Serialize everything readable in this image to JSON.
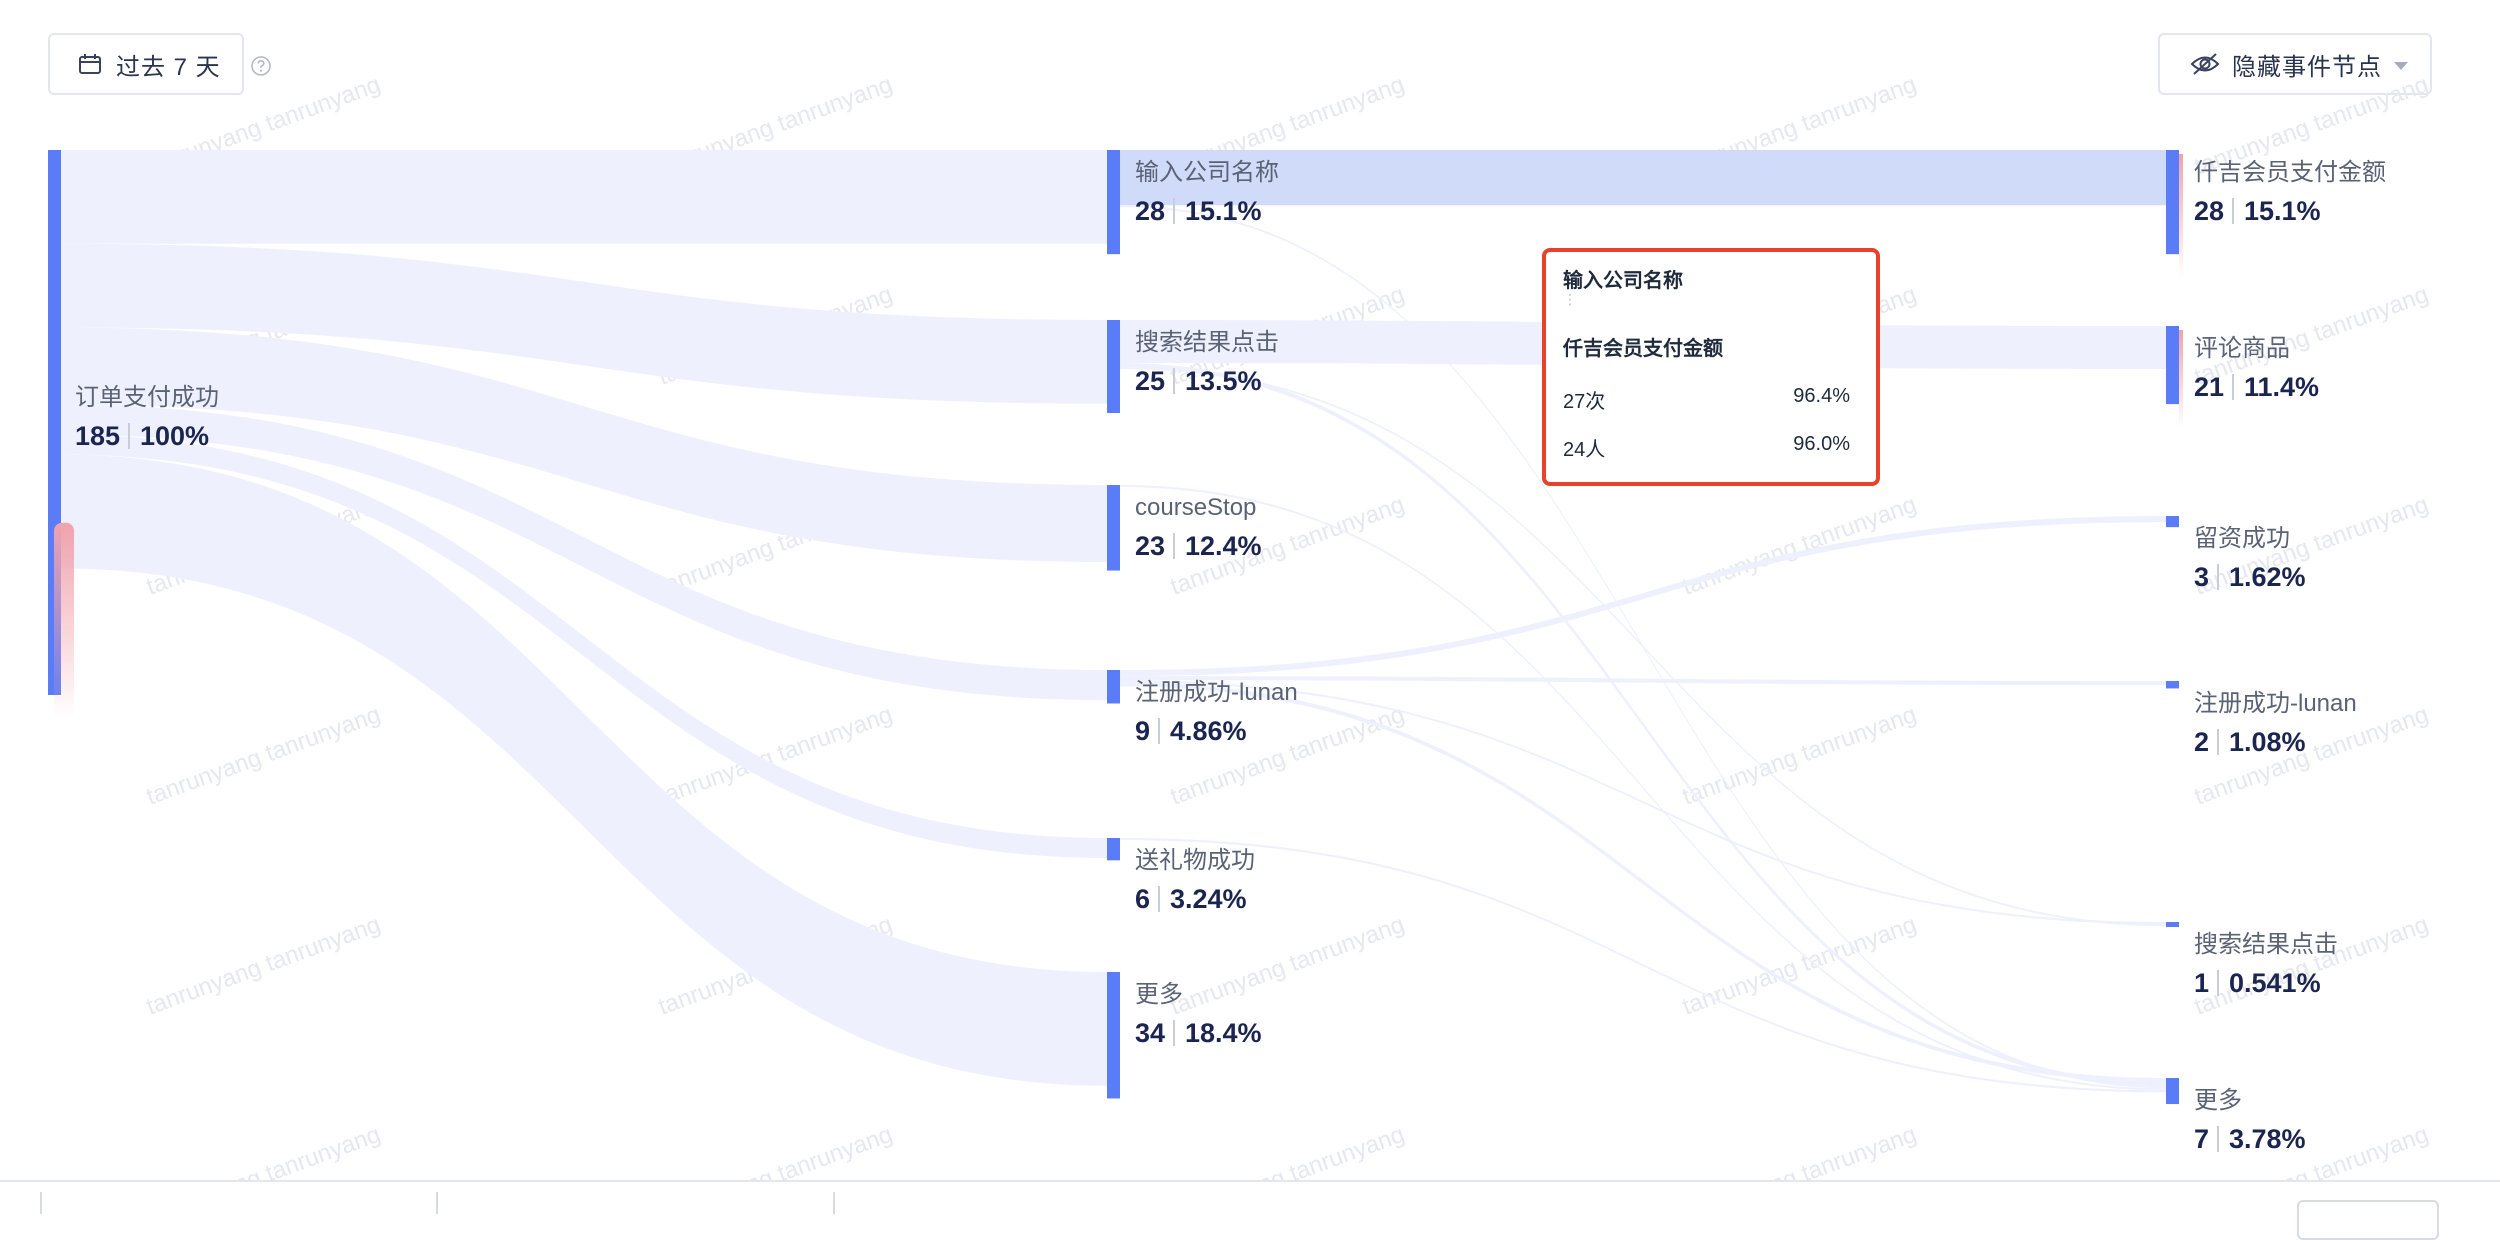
{
  "toolbar": {
    "date_range_label": "过去 7 天",
    "hide_nodes_label": "隐藏事件节点"
  },
  "watermark_text": "tanrunyang tanrunyang",
  "chart_data": {
    "type": "sankey",
    "nodes": [
      {
        "id": "start",
        "column": 0,
        "label": "订单支付成功",
        "count": 185,
        "percent": "100%",
        "dropoff_share": 0.34,
        "color": "#5b7cf7"
      },
      {
        "id": "s1_input",
        "column": 1,
        "label": "输入公司名称",
        "count": 28,
        "percent": "15.1%",
        "color": "#5b7cf7"
      },
      {
        "id": "s1_search",
        "column": 1,
        "label": "搜索结果点击",
        "count": 25,
        "percent": "13.5%",
        "color": "#5b7cf7"
      },
      {
        "id": "s1_course",
        "column": 1,
        "label": "courseStop",
        "count": 23,
        "percent": "12.4%",
        "color": "#5b7cf7"
      },
      {
        "id": "s1_reg",
        "column": 1,
        "label": "注册成功-lunan",
        "count": 9,
        "percent": "4.86%",
        "color": "#5b7cf7"
      },
      {
        "id": "s1_gift",
        "column": 1,
        "label": "送礼物成功",
        "count": 6,
        "percent": "3.24%",
        "color": "#5b7cf7"
      },
      {
        "id": "s1_more",
        "column": 1,
        "label": "更多",
        "count": 34,
        "percent": "18.4%",
        "color": "#5b7cf7"
      },
      {
        "id": "s2_pay",
        "column": 2,
        "label": "仟吉会员支付金额",
        "count": 28,
        "percent": "15.1%",
        "color": "#5b7cf7"
      },
      {
        "id": "s2_comment",
        "column": 2,
        "label": "评论商品",
        "count": 21,
        "percent": "11.4%",
        "color": "#5b7cf7"
      },
      {
        "id": "s2_lead",
        "column": 2,
        "label": "留资成功",
        "count": 3,
        "percent": "1.62%",
        "color": "#5b7cf7"
      },
      {
        "id": "s2_reg",
        "column": 2,
        "label": "注册成功-lunan",
        "count": 2,
        "percent": "1.08%",
        "color": "#5b7cf7"
      },
      {
        "id": "s2_search",
        "column": 2,
        "label": "搜索结果点击",
        "count": 1,
        "percent": "0.541%",
        "color": "#5b7cf7"
      },
      {
        "id": "s2_more",
        "column": 2,
        "label": "更多",
        "count": 7,
        "percent": "3.78%",
        "color": "#5b7cf7"
      }
    ],
    "links": [
      {
        "source": "start",
        "target": "s1_input",
        "value": 28
      },
      {
        "source": "start",
        "target": "s1_search",
        "value": 25
      },
      {
        "source": "start",
        "target": "s1_course",
        "value": 23
      },
      {
        "source": "start",
        "target": "s1_reg",
        "value": 9
      },
      {
        "source": "start",
        "target": "s1_gift",
        "value": 6
      },
      {
        "source": "start",
        "target": "s1_more",
        "value": 34
      },
      {
        "source": "s1_input",
        "target": "s2_pay",
        "value": 27,
        "highlight": true
      },
      {
        "source": "s1_search",
        "target": "s2_comment",
        "value": 21
      },
      {
        "source": "s1_reg",
        "target": "s2_lead",
        "value": 3
      },
      {
        "source": "s1_reg",
        "target": "s2_reg",
        "value": 2
      },
      {
        "source": "s1_reg",
        "target": "s2_search",
        "value": 1
      },
      {
        "source": "s1_reg",
        "target": "s2_more",
        "value": 2
      },
      {
        "source": "s1_search",
        "target": "s2_more",
        "value": 2
      },
      {
        "source": "s1_input",
        "target": "s2_more",
        "value": 1
      },
      {
        "source": "s1_course",
        "target": "s2_more",
        "value": 1
      },
      {
        "source": "s1_gift",
        "target": "s2_more",
        "value": 1
      },
      {
        "source": "s1_search",
        "target": "s2_search",
        "value": 0.5
      }
    ],
    "colors": {
      "node": "#5b7cf7",
      "link": "#edf0fd",
      "link_highlight": "#d0daf9",
      "dropoff": "#f0a3ad"
    }
  },
  "tooltip": {
    "from": "输入公司名称",
    "to": "仟吉会员支付金额",
    "times_label": "27次",
    "times_pct": "96.4%",
    "users_label": "24人",
    "users_pct": "96.0%"
  }
}
